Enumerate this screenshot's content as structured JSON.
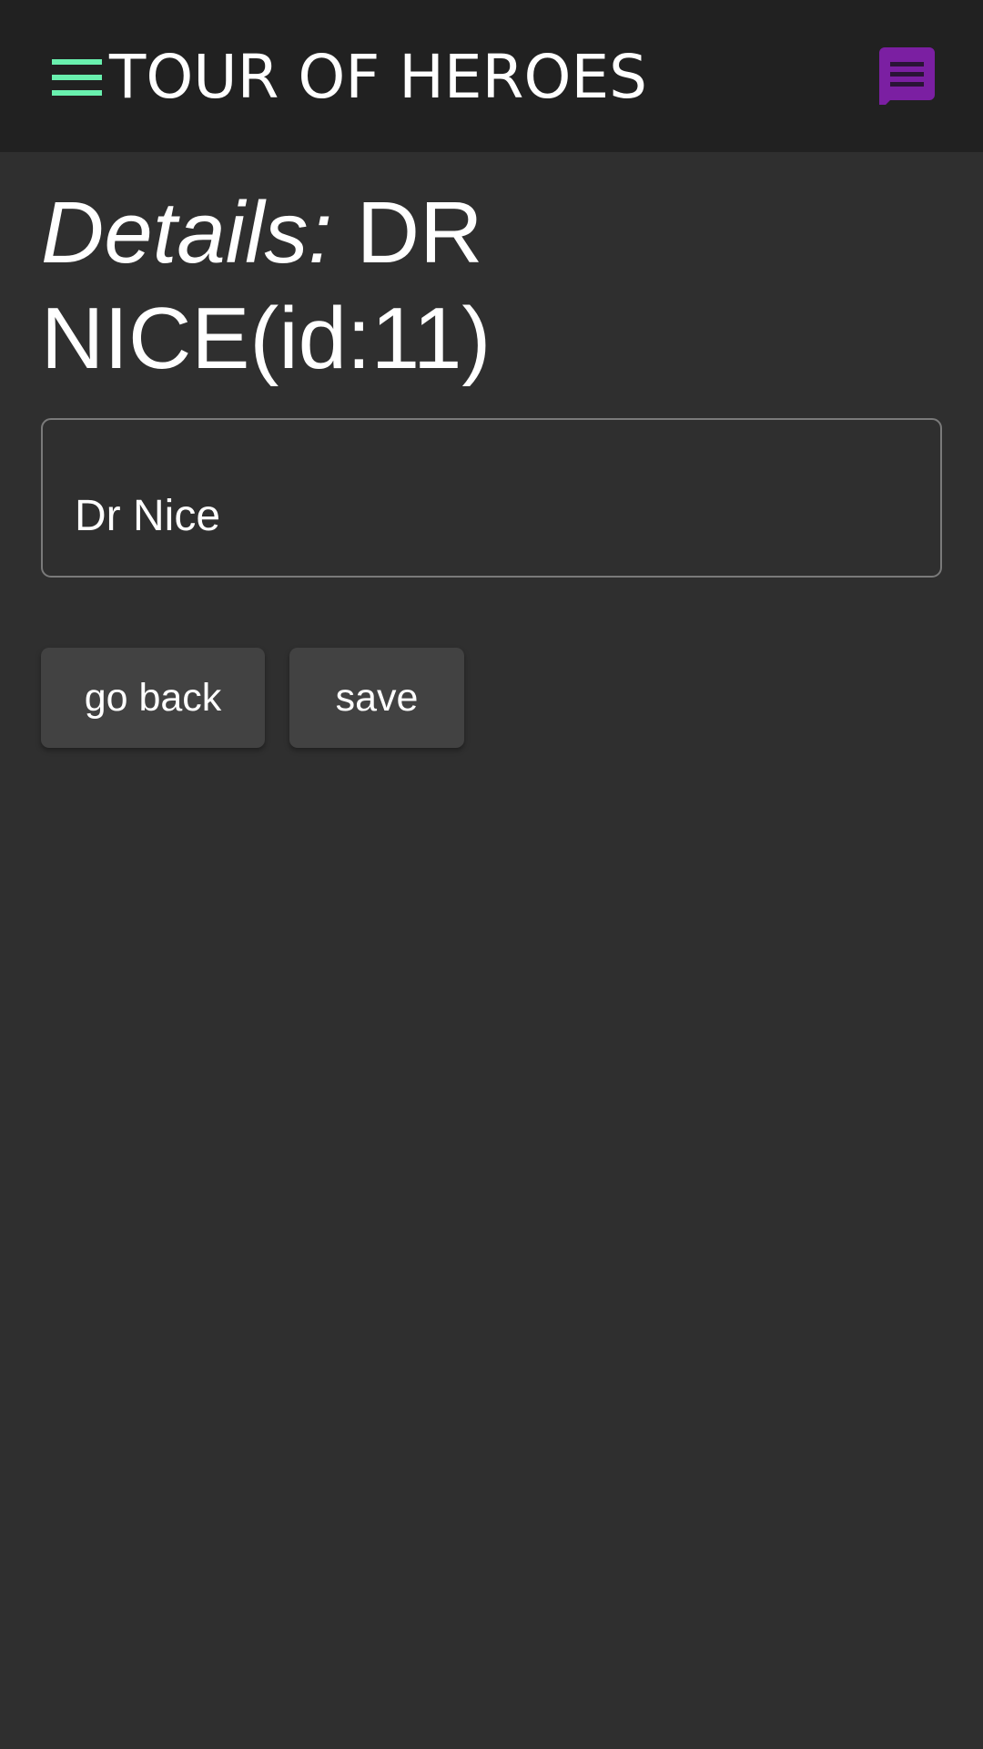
{
  "header": {
    "title": "TOUR OF HEROES",
    "menu_icon": "hamburger-menu-icon",
    "messages_icon": "messages-icon",
    "colors": {
      "menu_icon": "#69f0ae",
      "messages_icon": "#7b1fa2"
    }
  },
  "details": {
    "label": "Details:",
    "title": "DR NICE(id:11)"
  },
  "form": {
    "name_value": "Dr Nice"
  },
  "actions": {
    "back_label": "go back",
    "save_label": "save"
  }
}
